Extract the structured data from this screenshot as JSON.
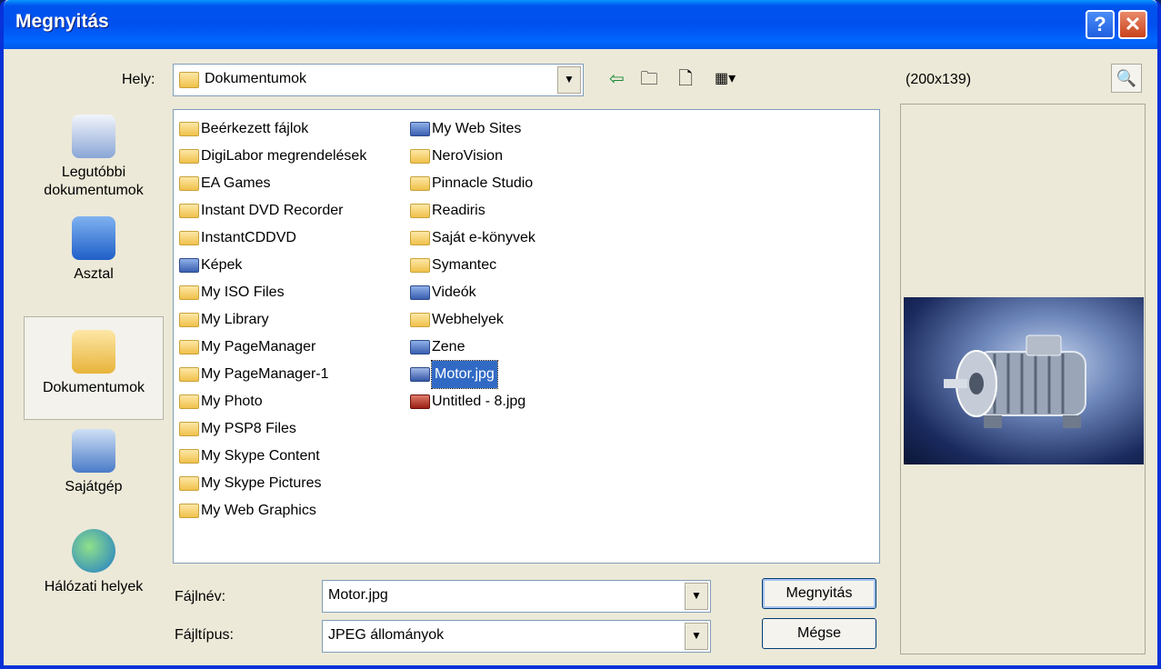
{
  "window": {
    "title": "Megnyitás"
  },
  "titlebar": {
    "help": "?",
    "close": "✕"
  },
  "location": {
    "label": "Hely:",
    "value": "Dokumentumok"
  },
  "preview": {
    "size_label": "(200x139)"
  },
  "places": [
    {
      "line1": "Legutóbbi",
      "line2": "dokumentumok"
    },
    {
      "line1": "Asztal",
      "line2": ""
    },
    {
      "line1": "Dokumentumok",
      "line2": ""
    },
    {
      "line1": "Sajátgép",
      "line2": ""
    },
    {
      "line1": "Hálózati helyek",
      "line2": ""
    }
  ],
  "files_col1": [
    "Beérkezett fájlok",
    "DigiLabor megrendelések",
    "EA Games",
    "Instant DVD Recorder",
    "InstantCDDVD",
    "Képek",
    "My ISO Files",
    "My Library",
    "My PageManager",
    "My PageManager-1",
    "My Photo",
    "My PSP8 Files",
    "My Skype Content",
    "My Skype Pictures",
    "My Web Graphics"
  ],
  "files_col2": [
    "My Web Sites",
    "NeroVision",
    "Pinnacle Studio",
    "Readiris",
    "Saját e-könyvek",
    "Symantec",
    "Videók",
    "Webhelyek",
    "Zene",
    "Motor.jpg",
    "Untitled - 8.jpg"
  ],
  "filename": {
    "label": "Fájlnév:",
    "value": "Motor.jpg"
  },
  "filetype": {
    "label": "Fájltípus:",
    "value": "JPEG állományok"
  },
  "buttons": {
    "open": "Megnyitás",
    "cancel": "Mégse"
  }
}
